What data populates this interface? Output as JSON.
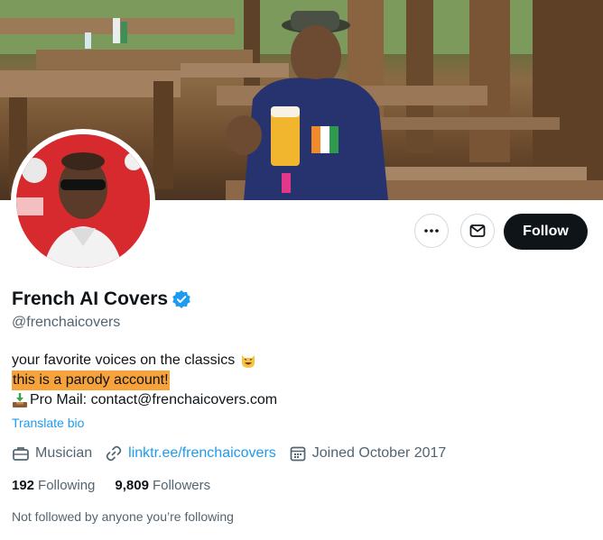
{
  "profile": {
    "display_name": "French AI Covers",
    "handle": "@frenchaicovers",
    "bio_line1": "your favorite voices on the classics",
    "bio_line2": "this is a parody account!",
    "bio_line3": "Pro Mail: contact@frenchaicovers.com",
    "translate_label": "Translate bio",
    "category": "Musician",
    "link": "linktr.ee/frenchaicovers",
    "joined": "Joined October 2017",
    "following_count": "192",
    "following_label": "Following",
    "followers_count": "9,809",
    "followers_label": "Followers",
    "not_followed": "Not followed by anyone you’re following"
  },
  "actions": {
    "follow_label": "Follow"
  },
  "colors": {
    "accent": "#1d9bf0",
    "highlight": "#f7a23b",
    "follow_bg": "#0f1419"
  },
  "icons": {
    "more": "more-icon",
    "message": "mail-icon",
    "verified": "verified-badge-icon",
    "category": "briefcase-icon",
    "link": "link-icon",
    "calendar": "calendar-icon"
  }
}
